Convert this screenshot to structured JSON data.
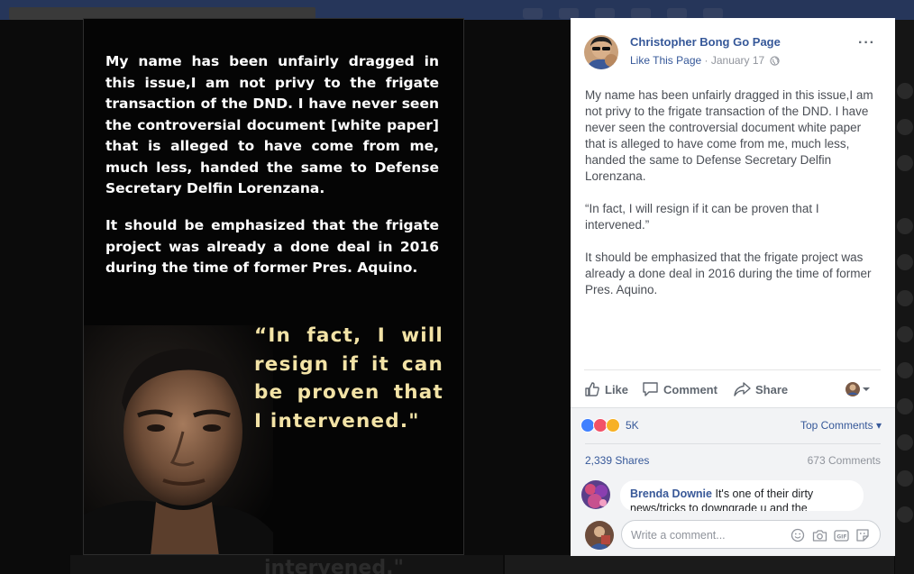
{
  "photo": {
    "paragraph1": "My name has been unfairly dragged in this issue,I am not privy to the frigate transaction of the DND. I have never seen the controversial document [white paper] that is alleged to have come from me, much less, handed the same to Defense Secretary Delfin Lorenzana.",
    "paragraph2": "It should be emphasized that the frigate project was already a done deal in 2016 during the time of former Pres. Aquino.",
    "quote": "“In fact, I will resign if it can be proven that I intervened.\"",
    "bottom_fragment": "intervened.\""
  },
  "post": {
    "page_name": "Christopher Bong Go Page",
    "like_page": "Like This Page",
    "separator": " · ",
    "date": "January 17",
    "more": "···",
    "body": [
      "My name has been unfairly dragged in this issue,I am not privy to the frigate transaction of the DND. I have never seen the controversial document white paper that is alleged to have come from me, much less, handed the same to Defense Secretary Delfin Lorenzana.",
      "“In fact, I will resign if it can be proven that I intervened.”",
      "It should be emphasized that the frigate project was already a done deal in 2016 during the time of former Pres. Aquino."
    ]
  },
  "actions": {
    "like": "Like",
    "comment": "Comment",
    "share": "Share"
  },
  "stats": {
    "reaction_count": "5K",
    "top_comments": "Top Comments ▾",
    "shares": "2,339 Shares",
    "comments": "673 Comments"
  },
  "comment": {
    "author": "Brenda Downie",
    "text": "It's one of their dirty news/tricks to downgrade u and the"
  },
  "composer": {
    "placeholder": "Write a comment..."
  },
  "colors": {
    "link": "#365899",
    "quote": "#f3e3a6",
    "like_blue": "#4080ff",
    "love_red": "#f25268",
    "sad_yellow": "#f7b125"
  }
}
